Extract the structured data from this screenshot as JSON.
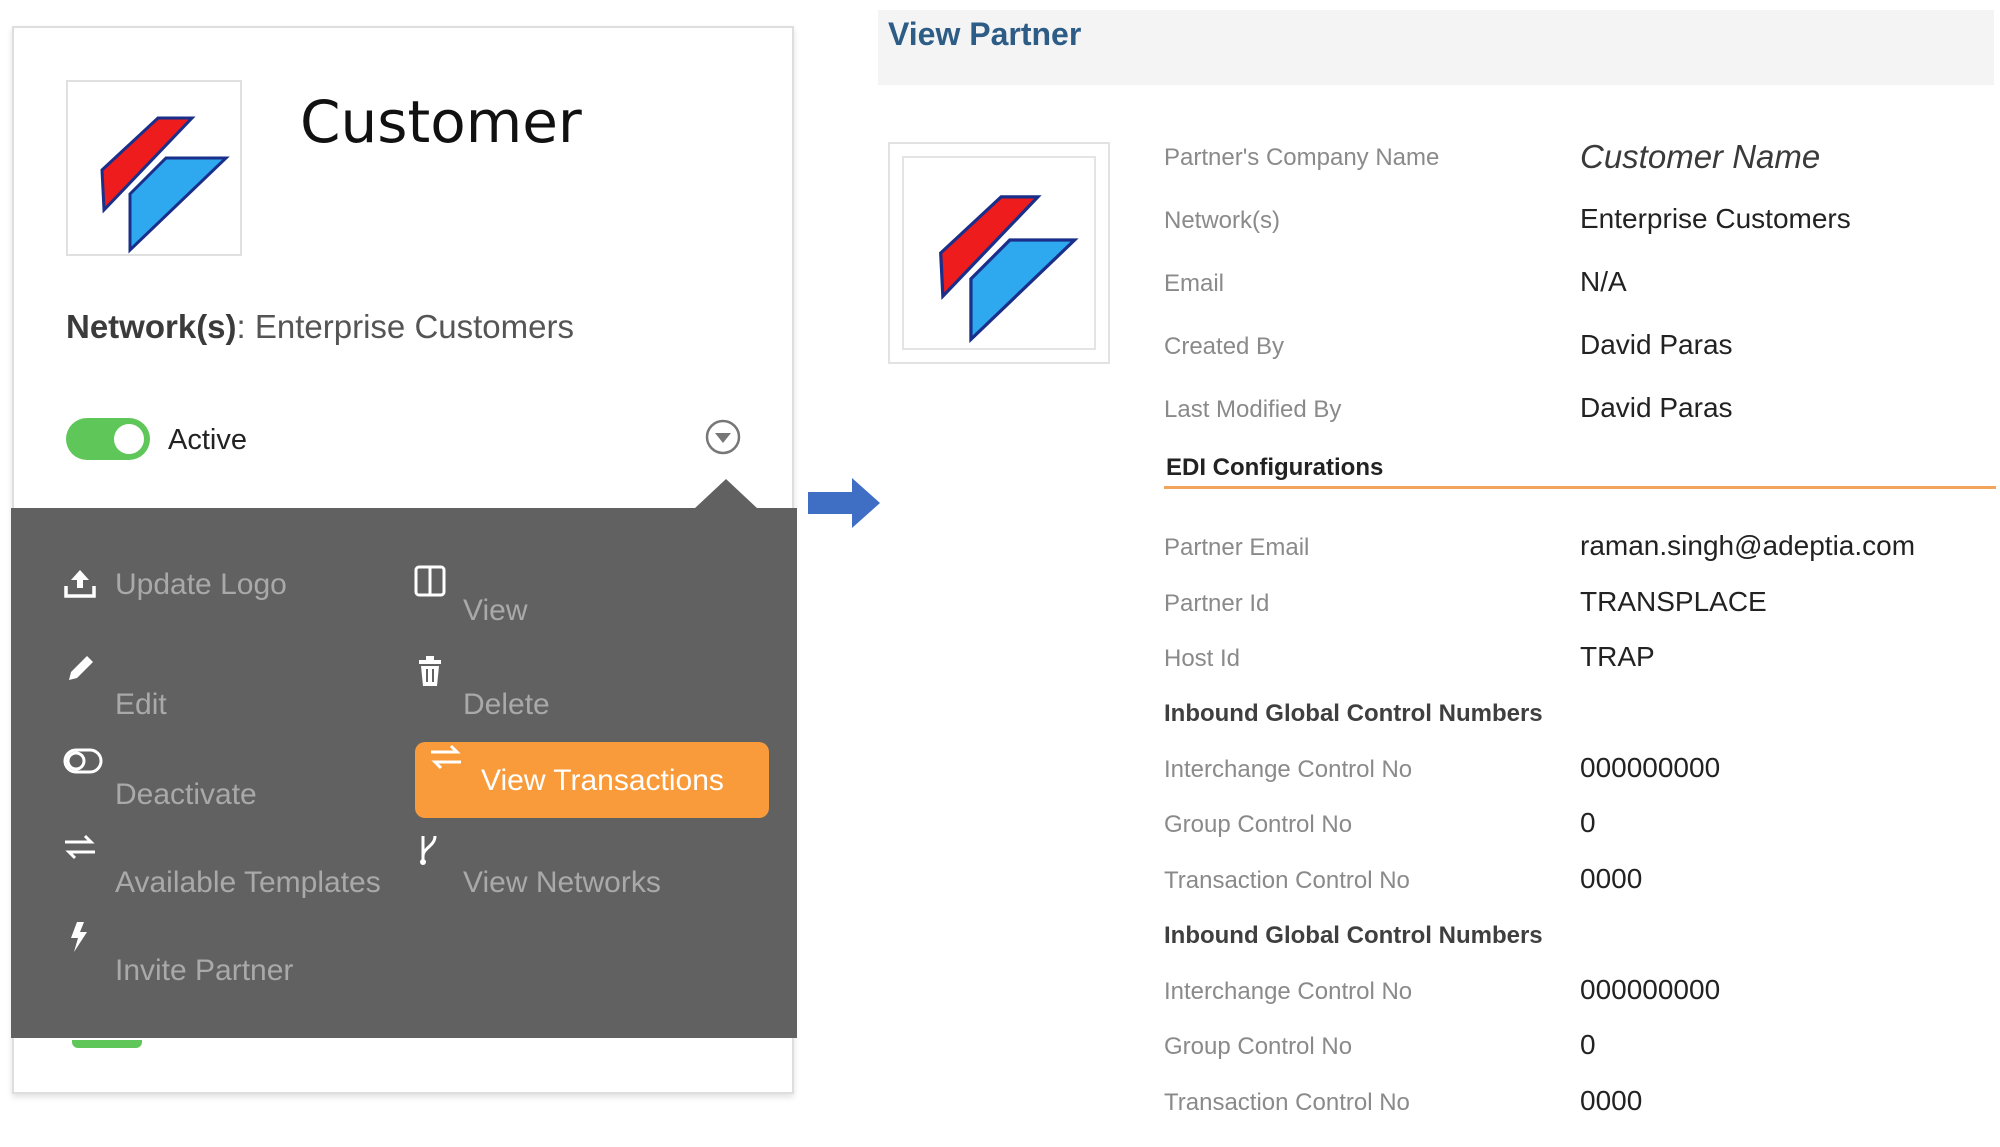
{
  "card": {
    "title": "Customer",
    "network_label": "Network(s)",
    "network_value": "Enterprise Customers",
    "status_label": "Active",
    "menu": {
      "update_logo": "Update Logo",
      "view": "View",
      "edit": "Edit",
      "delete": "Delete",
      "deactivate": "Deactivate",
      "view_transactions": "View Transactions",
      "available_templates": "Available Templates",
      "view_networks": "View Networks",
      "invite_partner": "Invite Partner"
    }
  },
  "view_partner": {
    "title": "View Partner",
    "rows": [
      {
        "label": "Partner's Company Name",
        "value": "Customer Name"
      },
      {
        "label": "Network(s)",
        "value": "Enterprise Customers"
      },
      {
        "label": "Email",
        "value": "N/A"
      },
      {
        "label": "Created By",
        "value": "David Paras"
      },
      {
        "label": "Last Modified By",
        "value": "David Paras"
      }
    ],
    "edi_heading": "EDI Configurations",
    "edi_rows": [
      {
        "label": "Partner Email",
        "value": "raman.singh@adeptia.com"
      },
      {
        "label": "Partner Id",
        "value": "TRANSPLACE"
      },
      {
        "label": "Host Id",
        "value": "TRAP"
      }
    ],
    "inbound_1": {
      "heading": "Inbound Global Control Numbers",
      "rows": [
        {
          "label": "Interchange Control No",
          "value": "000000000"
        },
        {
          "label": "Group Control No",
          "value": "0"
        },
        {
          "label": "Transaction Control No",
          "value": "0000"
        }
      ]
    },
    "inbound_2": {
      "heading": "Inbound Global Control Numbers",
      "rows": [
        {
          "label": "Interchange Control No",
          "value": "000000000"
        },
        {
          "label": "Group Control No",
          "value": "0"
        },
        {
          "label": "Transaction Control No",
          "value": "0000"
        }
      ]
    }
  },
  "colors": {
    "accent_orange": "#f99b3a",
    "menu_bg": "#616161",
    "toggle_green": "#5fc75a",
    "title_blue": "#2d5c86",
    "arrow_blue": "#3f6fc4",
    "logo_red": "#ee1c1c",
    "logo_blue": "#2ea8ee"
  },
  "icons": [
    "upload-icon",
    "columns-icon",
    "pencil-icon",
    "trash-icon",
    "toggle-icon",
    "transfer-icon",
    "branch-icon",
    "bolt-icon",
    "chevron-down-circle-icon",
    "arrow-right-icon"
  ]
}
